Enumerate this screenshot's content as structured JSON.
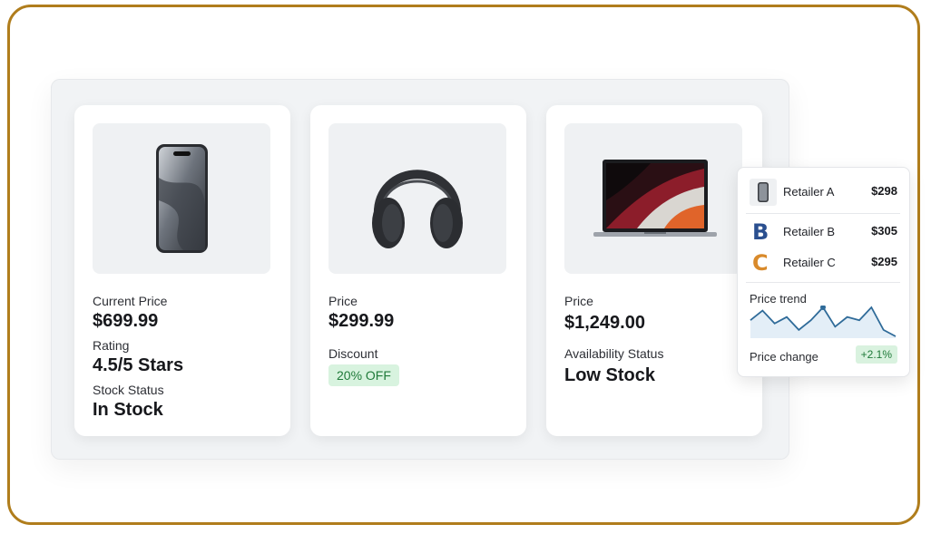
{
  "products": [
    {
      "name": "phone",
      "fields": [
        {
          "label": "Current Price",
          "value": "$699.99"
        },
        {
          "label": "Rating",
          "value": "4.5/5 Stars"
        },
        {
          "label": "Stock Status",
          "value": "In Stock"
        }
      ]
    },
    {
      "name": "headphones",
      "fields": [
        {
          "label": "Price",
          "value": "$299.99"
        },
        {
          "label": "Discount",
          "badge": "20% OFF"
        }
      ]
    },
    {
      "name": "laptop",
      "fields": [
        {
          "label": "Price",
          "value": "$1,249.00"
        },
        {
          "label": "Availability Status",
          "value": "Low Stock"
        }
      ]
    }
  ],
  "comparison": {
    "retailers": [
      {
        "name": "Retailer A",
        "price": "$298",
        "logo": "phone-thumbnail-icon"
      },
      {
        "name": "Retailer B",
        "price": "$305",
        "logo": "B"
      },
      {
        "name": "Retailer C",
        "price": "$295",
        "logo": "C"
      }
    ],
    "trend_label": "Price trend",
    "change_label": "Price change",
    "change_value": "+2.1%",
    "colors": {
      "accent": "#2f6b99",
      "retailer_b": "#2a4f8f",
      "retailer_c": "#d98a2b",
      "positive": "#1f7a39"
    }
  },
  "chart_data": {
    "type": "area",
    "title": "Price trend",
    "values": [
      8,
      11,
      7,
      9,
      5,
      8,
      12,
      6,
      9,
      8,
      12,
      5,
      3
    ],
    "highlight_index": 6
  }
}
